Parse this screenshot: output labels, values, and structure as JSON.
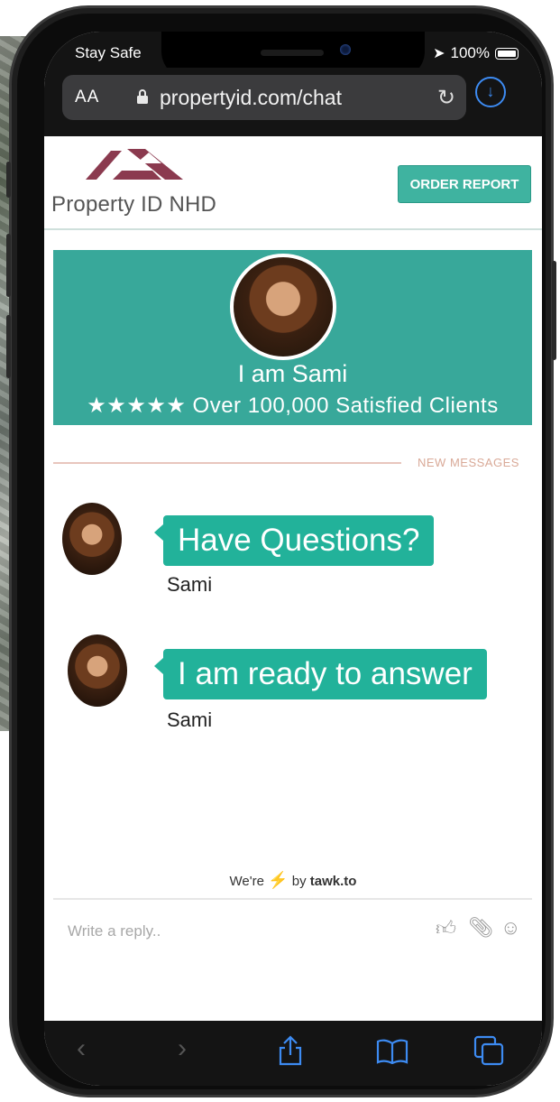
{
  "status_bar": {
    "carrier": "Stay Safe",
    "battery": "100%"
  },
  "browser": {
    "text_size": "AA",
    "url": "propertyid.com/chat"
  },
  "site": {
    "logo_text": "Property ID NHD",
    "order_button": "ORDER REPORT"
  },
  "hero": {
    "name": "I am Sami",
    "stars": "★★★★★",
    "tagline": "Over 100,000 Satisfied Clients"
  },
  "chat": {
    "new_messages_label": "NEW MESSAGES",
    "messages": [
      {
        "text": "Have Questions?",
        "sender": "Sami"
      },
      {
        "text": "I am ready to answer",
        "sender": "Sami"
      }
    ]
  },
  "powered_by": {
    "prefix": "We're",
    "by": "by",
    "brand": "tawk.to"
  },
  "compose": {
    "placeholder": "Write a reply.."
  },
  "colors": {
    "teal": "#38a89a",
    "bubble": "#22b29a",
    "logo": "#8b3a4f",
    "link_blue": "#3d8bf2"
  }
}
